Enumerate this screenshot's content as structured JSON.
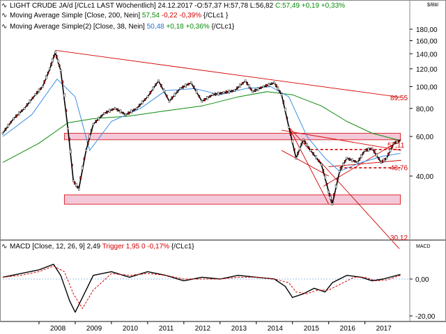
{
  "units_label": "$/Bbl",
  "legend": {
    "line1": {
      "symbol": "∿",
      "name": "LIGHT CRUDE JA/d [/CLc1 LAST Wöchentlich] 24.12.2017 -",
      "ohlc": "O:57,37 H:57,78 L:56,82",
      "close": "C:57,49 +0,19 +0,33%"
    },
    "line2": {
      "symbol": "∿",
      "name": "Moving Average Simple [Close, 200, Nein]",
      "value": "57,54",
      "change": "-0,22 -0,39%",
      "ticker": "{/CLc1 }"
    },
    "line3": {
      "symbol": "∿",
      "name": "Moving Average Simple(2) [Close, 38, Nein]",
      "value": "50,48",
      "change": "+0,18 +0,36%",
      "ticker": "{/CLc1}"
    }
  },
  "macd_legend": {
    "symbol": "∿",
    "name": "MACD [Close, 12, 26, 9]",
    "value": "2,49",
    "trigger": "Trigger 1,95 0 -0,17%",
    "ticker": "{/CLc1}"
  },
  "macd_units": "MACD",
  "annotations": {
    "resistance": "89,55",
    "current": "57,11",
    "support": "43,76",
    "low_line": "30,12"
  },
  "colors": {
    "price": "#000000",
    "ma200": "#0a8a0a",
    "ma38": "#3a8ee6",
    "trend": "#d40000",
    "band": "#f3c8d8",
    "macd": "#000000",
    "signal": "#d40000"
  },
  "chart_data": [
    {
      "type": "line",
      "title": "LIGHT CRUDE JA/d [/CLc1 LAST Wöchentlich]",
      "ylabel": "$/Bbl",
      "y_scale": "log",
      "ylim": [
        19,
        200
      ],
      "y_ticks": [
        40,
        60,
        80,
        100,
        120,
        140,
        160,
        180
      ],
      "x_ticks": [
        "2008",
        "2009",
        "2010",
        "2011",
        "2012",
        "2013",
        "2014",
        "2015",
        "2016",
        "2017"
      ],
      "grid": false,
      "legend_placement": "top-left",
      "series": [
        {
          "name": "LIGHT CRUDE JA/d",
          "x": [
            2007.0,
            2007.3,
            2007.6,
            2007.9,
            2008.1,
            2008.3,
            2008.45,
            2008.6,
            2008.8,
            2008.95,
            2009.1,
            2009.3,
            2009.5,
            2009.8,
            2010.1,
            2010.4,
            2010.7,
            2011.0,
            2011.3,
            2011.6,
            2011.9,
            2012.2,
            2012.5,
            2012.8,
            2013.1,
            2013.4,
            2013.7,
            2013.9,
            2014.2,
            2014.5,
            2014.7,
            2014.9,
            2015.1,
            2015.3,
            2015.5,
            2015.8,
            2016.0,
            2016.1,
            2016.3,
            2016.5,
            2016.8,
            2017.0,
            2017.2,
            2017.45,
            2017.6,
            2017.8,
            2017.98
          ],
          "y": [
            62,
            72,
            80,
            92,
            100,
            120,
            142,
            118,
            65,
            38,
            35,
            52,
            68,
            76,
            80,
            75,
            80,
            90,
            106,
            86,
            98,
            104,
            86,
            92,
            94,
            96,
            106,
            95,
            100,
            104,
            92,
            66,
            48,
            58,
            52,
            45,
            34,
            30,
            42,
            48,
            46,
            52,
            53,
            46,
            48,
            56,
            57.49
          ]
        },
        {
          "name": "Moving Average Simple [Close, 200, Nein]",
          "x": [
            2007.0,
            2008.0,
            2008.8,
            2009.5,
            2010.5,
            2011.5,
            2012.5,
            2013.5,
            2014.3,
            2015.0,
            2015.8,
            2016.5,
            2017.2,
            2017.98
          ],
          "y": [
            46,
            56,
            69,
            72,
            74,
            78,
            82,
            90,
            95,
            92,
            82,
            70,
            62,
            57.54
          ]
        },
        {
          "name": "Moving Average Simple(2) [Close, 38, Nein]",
          "x": [
            2007.0,
            2007.8,
            2008.5,
            2009.0,
            2009.4,
            2010.0,
            2010.8,
            2011.5,
            2012.3,
            2013.0,
            2013.7,
            2014.4,
            2014.9,
            2015.4,
            2015.9,
            2016.3,
            2016.9,
            2017.5,
            2017.98
          ],
          "y": [
            60,
            75,
            108,
            90,
            52,
            70,
            80,
            96,
            98,
            92,
            98,
            100,
            90,
            60,
            48,
            42,
            46,
            49,
            50.48
          ]
        }
      ]
    },
    {
      "type": "line",
      "title": "MACD [Close, 12, 26, 9]",
      "ylabel": "MACD",
      "ylim": [
        -22,
        14
      ],
      "y_ticks": [
        -20,
        0
      ],
      "legend_placement": "top-left",
      "series": [
        {
          "name": "MACD",
          "x": [
            2007.0,
            2007.5,
            2008.0,
            2008.4,
            2008.6,
            2008.85,
            2009.0,
            2009.2,
            2009.5,
            2010.0,
            2010.5,
            2011.0,
            2011.5,
            2012.0,
            2012.5,
            2013.0,
            2013.5,
            2014.0,
            2014.5,
            2014.8,
            2015.0,
            2015.3,
            2015.6,
            2015.9,
            2016.1,
            2016.5,
            2016.9,
            2017.2,
            2017.5,
            2017.98
          ],
          "y": [
            1,
            3,
            5,
            8,
            2,
            -12,
            -18,
            -10,
            2,
            4,
            1,
            4,
            2,
            -1,
            1,
            0,
            2,
            1,
            0,
            -4,
            -10,
            -8,
            -5,
            -7,
            -2,
            2,
            1,
            -1,
            0,
            2.49
          ]
        },
        {
          "name": "Trigger",
          "x": [
            2007.0,
            2007.5,
            2008.0,
            2008.4,
            2008.7,
            2008.95,
            2009.2,
            2009.5,
            2010.0,
            2010.5,
            2011.0,
            2011.5,
            2012.0,
            2012.5,
            2013.0,
            2013.5,
            2014.0,
            2014.5,
            2014.9,
            2015.1,
            2015.4,
            2015.7,
            2016.0,
            2016.3,
            2016.7,
            2017.0,
            2017.3,
            2017.6,
            2017.98
          ],
          "y": [
            1,
            2,
            4,
            7,
            4,
            -8,
            -16,
            -6,
            3,
            2,
            3,
            2,
            0,
            0,
            0,
            1,
            1,
            0,
            -2,
            -7,
            -8,
            -6,
            -6,
            -3,
            1,
            1,
            -1,
            -0.5,
            1.95
          ]
        }
      ]
    }
  ]
}
